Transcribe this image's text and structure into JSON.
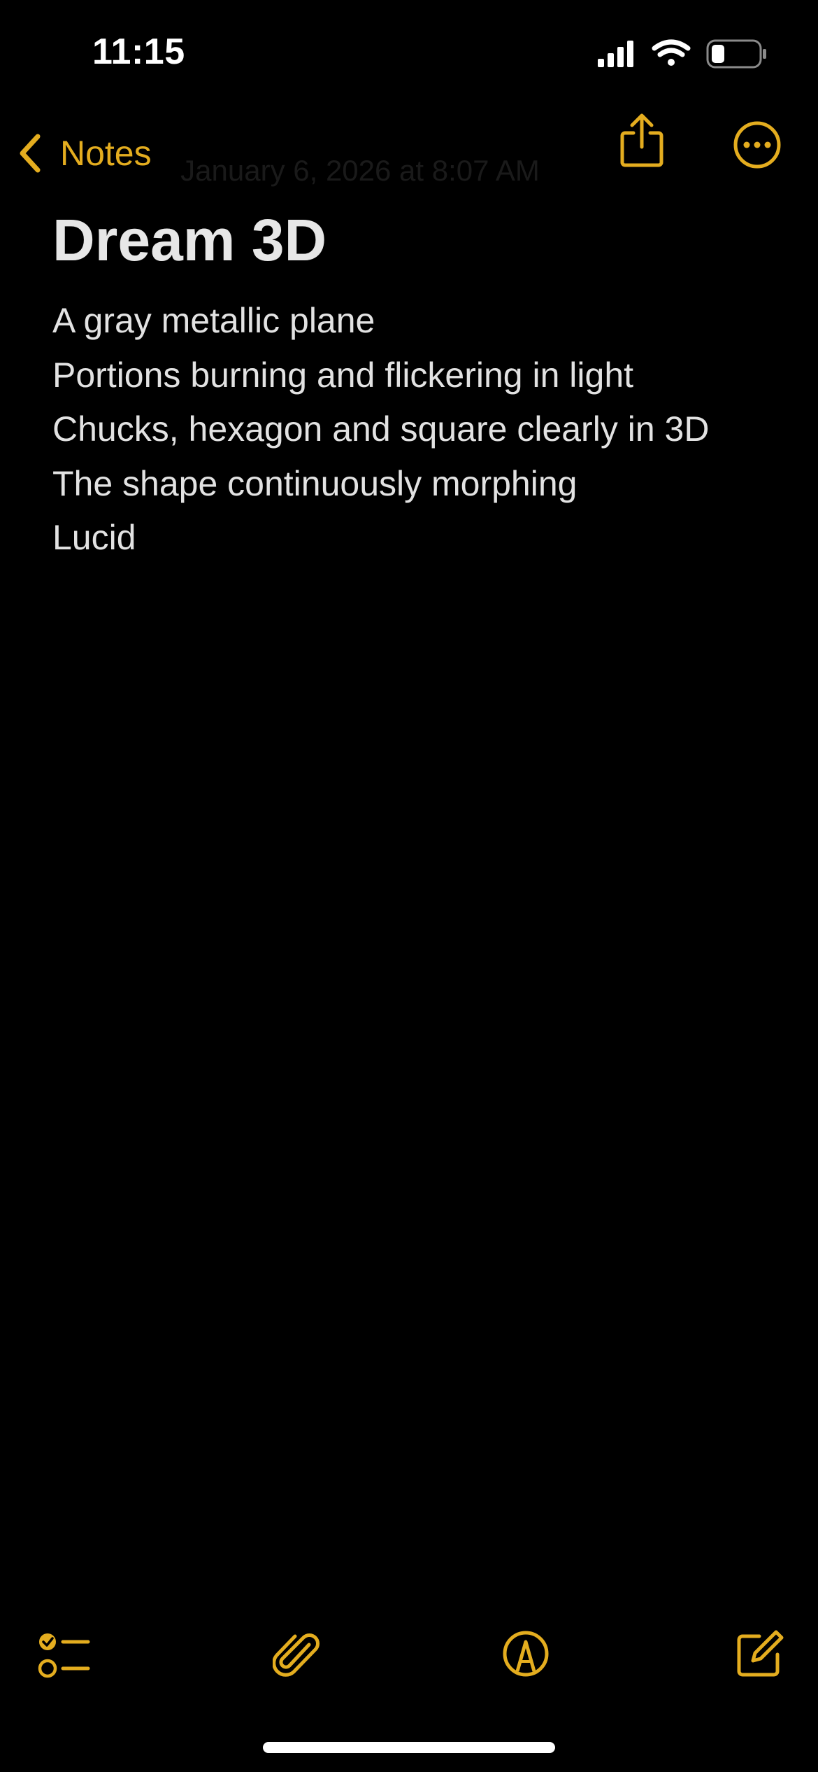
{
  "status_bar": {
    "time": "11:15",
    "icons": [
      "cellular-signal-icon",
      "wifi-icon",
      "battery-icon"
    ]
  },
  "nav": {
    "back_label": "Notes",
    "date_line": "January 6, 2026 at 8:07 AM",
    "actions": [
      "share-icon",
      "more-icon"
    ]
  },
  "note": {
    "title": "Dream 3D",
    "lines": [
      "A gray metallic plane",
      "Portions burning and flickering in light",
      "Chucks, hexagon and square clearly in 3D",
      "The shape continuously morphing",
      "Lucid"
    ]
  },
  "toolbar": {
    "items": [
      "checklist-icon",
      "attachment-icon",
      "markup-icon",
      "compose-icon"
    ]
  },
  "colors": {
    "accent": "#e4ad1f",
    "background": "#000000",
    "text": "#e2e2e2"
  }
}
